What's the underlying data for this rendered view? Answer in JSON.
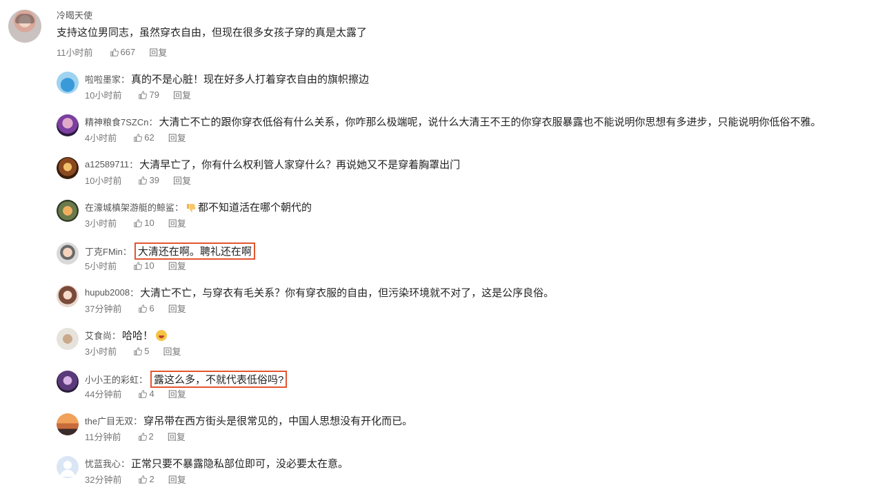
{
  "main_comment": {
    "username": "冷暍天使",
    "text": "支持这位男同志，虽然穿衣自由，但现在很多女孩子穿的真是太露了",
    "time": "11小时前",
    "likes": "667",
    "reply_label": "回复"
  },
  "replies": [
    {
      "username": "啦啦墨家",
      "colon": "：",
      "text": "真的不是心脏！现在好多人打着穿衣自由的旗帜擦边",
      "time": "10小时前",
      "likes": "79",
      "reply_label": "回复"
    },
    {
      "username": "精神粮食7SZCn",
      "colon": "：",
      "text": "大清亡不亡的跟你穿衣低俗有什么关系，你咋那么极端呢，说什么大清王不王的你穿衣服暴露也不能说明你思想有多进步，只能说明你低俗不雅。",
      "time": "4小时前",
      "likes": "62",
      "reply_label": "回复"
    },
    {
      "username": "a12589711",
      "colon": "：",
      "text": "大清早亡了，你有什么权利管人家穿什么？再说她又不是穿着胸罩出门",
      "time": "10小时前",
      "likes": "39",
      "reply_label": "回复"
    },
    {
      "username": "在濠城槙架游艇的鲸鲨",
      "colon": "：",
      "text": "都不知道活在哪个朝代的",
      "time": "3小时前",
      "likes": "10",
      "reply_label": "回复",
      "emoji_before": "thumbs-down-emoji"
    },
    {
      "username": "丁克FMin",
      "colon": "：",
      "text": "大清还在啊。聘礼还在啊",
      "time": "5小时前",
      "likes": "10",
      "reply_label": "回复",
      "highlight": true
    },
    {
      "username": "hupub2008",
      "colon": "：",
      "text": "大清亡不亡，与穿衣有毛关系？你有穿衣服的自由，但污染环境就不对了，这是公序良俗。",
      "time": "37分钟前",
      "likes": "6",
      "reply_label": "回复"
    },
    {
      "username": "艾食尚",
      "colon": "：",
      "text": "哈哈！",
      "time": "3小时前",
      "likes": "5",
      "reply_label": "回复",
      "emoji_after": "laughing-emoji"
    },
    {
      "username": "小小王的彩虹",
      "colon": "：",
      "text": "露这么多，不就代表低俗吗?",
      "time": "44分钟前",
      "likes": "4",
      "reply_label": "回复",
      "highlight": true
    },
    {
      "username": "the广目无双",
      "colon": "：",
      "text": "穿吊带在西方街头是很常见的，中国人思想没有开化而已。",
      "time": "11分钟前",
      "likes": "2",
      "reply_label": "回复"
    },
    {
      "username": "忧蓝我心",
      "colon": "：",
      "text": "正常只要不暴露隐私部位即可，没必要太在意。",
      "time": "32分钟前",
      "likes": "2",
      "reply_label": "回复"
    }
  ],
  "colors": {
    "highlight_border": "#e3542e",
    "meta_text": "#777777",
    "username_text": "#555555"
  }
}
